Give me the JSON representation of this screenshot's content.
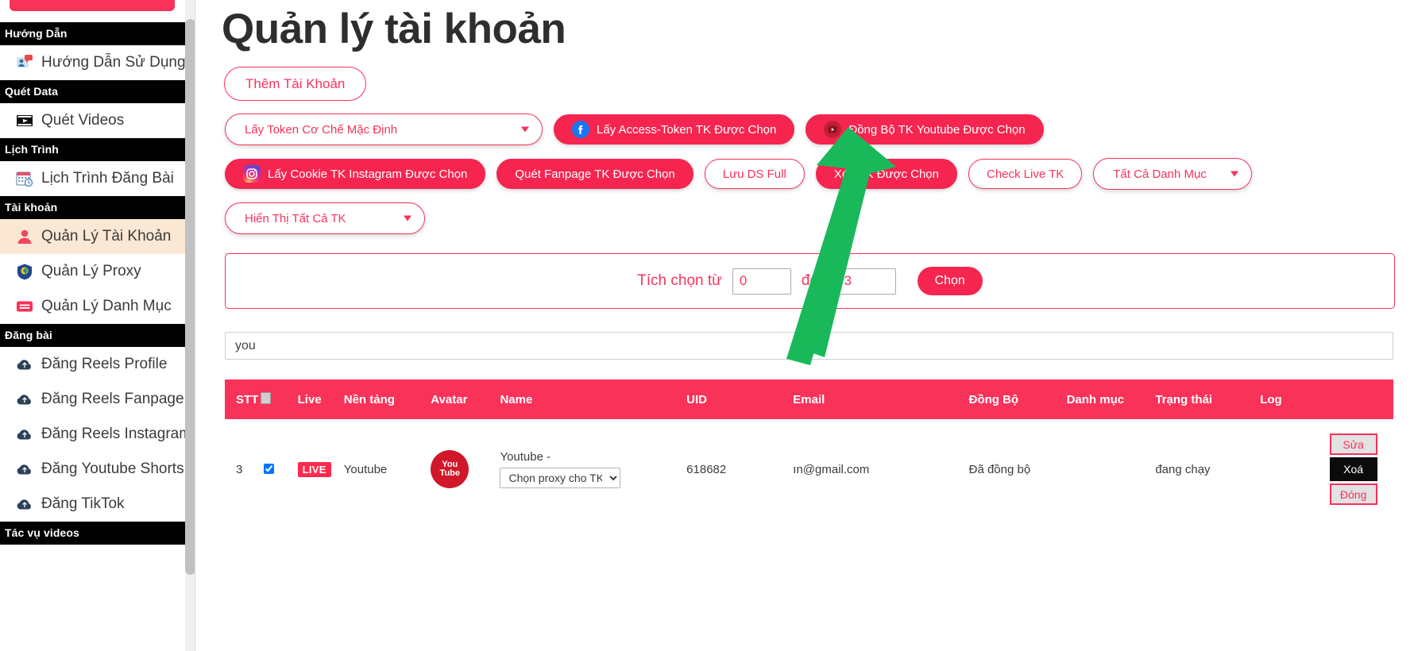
{
  "sidebar": {
    "groups": [
      {
        "title": "Hướng Dẫn",
        "items": [
          {
            "label": "Hướng Dẫn Sử Dụng",
            "icon": "tutorial-icon",
            "active": false
          }
        ]
      },
      {
        "title": "Quét Data",
        "items": [
          {
            "label": "Quét Videos",
            "icon": "video-icon",
            "active": false
          }
        ]
      },
      {
        "title": "Lịch Trình",
        "items": [
          {
            "label": "Lịch Trình Đăng Bài",
            "icon": "calendar-icon",
            "active": false
          }
        ]
      },
      {
        "title": "Tài khoản",
        "items": [
          {
            "label": "Quản Lý Tài Khoản",
            "icon": "user-icon",
            "active": true
          },
          {
            "label": "Quản Lý Proxy",
            "icon": "shield-icon",
            "active": false
          },
          {
            "label": "Quản Lý Danh Mục",
            "icon": "list-icon",
            "active": false
          }
        ]
      },
      {
        "title": "Đăng bài",
        "items": [
          {
            "label": "Đăng Reels Profile",
            "icon": "cloud-upload-icon",
            "active": false
          },
          {
            "label": "Đăng Reels Fanpage",
            "icon": "cloud-upload-icon",
            "active": false
          },
          {
            "label": "Đăng Reels Instagram",
            "icon": "cloud-upload-icon",
            "active": false
          },
          {
            "label": "Đăng Youtube Shorts",
            "icon": "cloud-upload-icon",
            "active": false
          },
          {
            "label": "Đăng TikTok",
            "icon": "cloud-upload-icon",
            "active": false
          }
        ]
      },
      {
        "title": "Tác vụ videos",
        "items": []
      }
    ]
  },
  "header": {
    "title": "Quản lý tài khoản",
    "add_account_label": "Thêm Tài Khoản"
  },
  "toolbar": {
    "token_mode_select": "Lấy Token Cơ Chế Mặc Định",
    "get_access_token_label": "Lấy Access-Token TK Được Chọn",
    "sync_youtube_label": "Đồng Bộ TK Youtube Được Chọn",
    "get_cookie_instagram_label": "Lấy Cookie TK Instagram Được Chọn",
    "scan_fanpage_label": "Quét Fanpage TK Được Chọn",
    "save_full_list_label": "Lưu DS Full",
    "delete_selected_label": "Xóa TK Được Chọn",
    "check_live_label": "Check Live TK",
    "category_select": "Tất Cả Danh Mục",
    "show_all_select": "Hiển Thị Tất Cả TK"
  },
  "selection": {
    "label_from": "Tích chọn từ",
    "from_value": "0",
    "label_to": "đến",
    "to_value": "3",
    "confirm_label": "Chọn"
  },
  "search": {
    "value": "you",
    "placeholder": ""
  },
  "table": {
    "columns": [
      "STT",
      "",
      "Live",
      "Nền tảng",
      "Avatar",
      "Name",
      "UID",
      "Email",
      "Đồng Bộ",
      "Danh mục",
      "Trạng thái",
      "Log"
    ],
    "rows": [
      {
        "stt": "3",
        "checked": true,
        "live": "LIVE",
        "platform": "Youtube",
        "avatar_line1": "You",
        "avatar_line2": "Tube",
        "name": "Youtube -",
        "proxy_select": "Chọn proxy cho TK",
        "uid": "618682",
        "email": "ın@gmail.com",
        "sync": "Đã đồng bộ",
        "category": "",
        "status": "đang chạy",
        "log": "",
        "actions": {
          "edit": "Sửa",
          "delete": "Xoá",
          "close": "Đóng"
        }
      }
    ]
  },
  "colors": {
    "accent": "#f7325c",
    "accent_solid": "#f5254f",
    "header_row": "#f9325a",
    "active_sidebar": "#fbe8d4",
    "arrow": "#19b95a"
  }
}
